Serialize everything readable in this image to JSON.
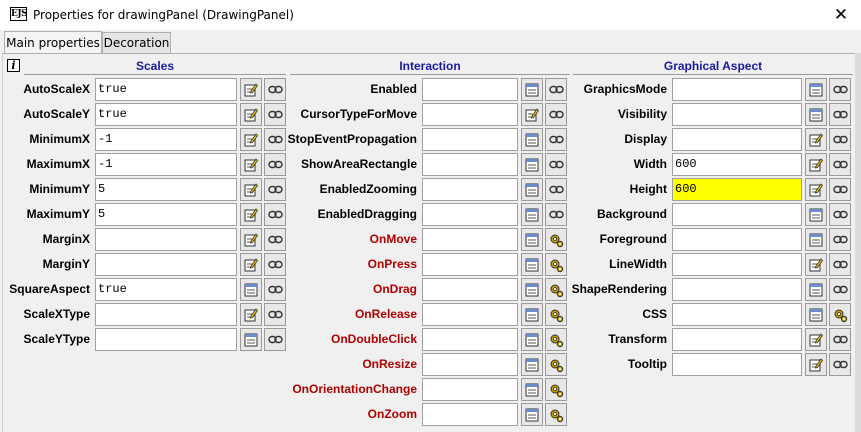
{
  "window": {
    "app_icon_text": "EJS",
    "title": "Properties for drawingPanel (DrawingPanel)"
  },
  "tabs": [
    {
      "label": "Main properties",
      "active": true
    },
    {
      "label": "Decoration",
      "active": false
    }
  ],
  "columns": [
    {
      "header": "Scales",
      "rows": [
        {
          "label": "AutoScaleX",
          "value": "true",
          "kind": "property",
          "edit_icon": "edit-icon"
        },
        {
          "label": "AutoScaleY",
          "value": "true",
          "kind": "property",
          "edit_icon": "edit-icon"
        },
        {
          "label": "MinimumX",
          "value": "-1",
          "kind": "property",
          "edit_icon": "edit-icon"
        },
        {
          "label": "MaximumX",
          "value": "-1",
          "kind": "property",
          "edit_icon": "edit-icon"
        },
        {
          "label": "MinimumY",
          "value": "5",
          "kind": "property",
          "edit_icon": "edit-icon"
        },
        {
          "label": "MaximumY",
          "value": "5",
          "kind": "property",
          "edit_icon": "edit-icon"
        },
        {
          "label": "MarginX",
          "value": "",
          "kind": "property",
          "edit_icon": "edit-icon"
        },
        {
          "label": "MarginY",
          "value": "",
          "kind": "property",
          "edit_icon": "edit-icon"
        },
        {
          "label": "SquareAspect",
          "value": "true",
          "kind": "property",
          "edit_icon": "list-icon"
        },
        {
          "label": "ScaleXType",
          "value": "",
          "kind": "property",
          "edit_icon": "edit-icon"
        },
        {
          "label": "ScaleYType",
          "value": "",
          "kind": "property",
          "edit_icon": "list-icon"
        }
      ]
    },
    {
      "header": "Interaction",
      "rows": [
        {
          "label": "Enabled",
          "value": "",
          "kind": "property",
          "edit_icon": "list-icon"
        },
        {
          "label": "CursorTypeForMove",
          "value": "",
          "kind": "property",
          "edit_icon": "edit-icon"
        },
        {
          "label": "StopEventPropagation",
          "value": "",
          "kind": "property",
          "edit_icon": "list-icon"
        },
        {
          "label": "ShowAreaRectangle",
          "value": "",
          "kind": "property",
          "edit_icon": "list-icon"
        },
        {
          "label": "EnabledZooming",
          "value": "",
          "kind": "property",
          "edit_icon": "list-icon"
        },
        {
          "label": "EnabledDragging",
          "value": "",
          "kind": "property",
          "edit_icon": "list-icon"
        },
        {
          "label": "OnMove",
          "value": "",
          "kind": "action",
          "edit_icon": "list-icon"
        },
        {
          "label": "OnPress",
          "value": "",
          "kind": "action",
          "edit_icon": "list-icon"
        },
        {
          "label": "OnDrag",
          "value": "",
          "kind": "action",
          "edit_icon": "list-icon"
        },
        {
          "label": "OnRelease",
          "value": "",
          "kind": "action",
          "edit_icon": "list-icon"
        },
        {
          "label": "OnDoubleClick",
          "value": "",
          "kind": "action",
          "edit_icon": "list-icon"
        },
        {
          "label": "OnResize",
          "value": "",
          "kind": "action",
          "edit_icon": "list-icon"
        },
        {
          "label": "OnOrientationChange",
          "value": "",
          "kind": "action",
          "edit_icon": "list-icon"
        },
        {
          "label": "OnZoom",
          "value": "",
          "kind": "action",
          "edit_icon": "list-icon"
        }
      ]
    },
    {
      "header": "Graphical Aspect",
      "rows": [
        {
          "label": "GraphicsMode",
          "value": "",
          "kind": "property",
          "edit_icon": "list-icon"
        },
        {
          "label": "Visibility",
          "value": "",
          "kind": "property",
          "edit_icon": "list-icon"
        },
        {
          "label": "Display",
          "value": "",
          "kind": "property",
          "edit_icon": "edit-icon"
        },
        {
          "label": "Width",
          "value": "600",
          "kind": "property",
          "edit_icon": "edit-icon"
        },
        {
          "label": "Height",
          "value": "600",
          "kind": "property",
          "edit_icon": "edit-icon",
          "highlighted": true
        },
        {
          "label": "Background",
          "value": "",
          "kind": "property",
          "edit_icon": "list-icon"
        },
        {
          "label": "Foreground",
          "value": "",
          "kind": "property",
          "edit_icon": "list-icon"
        },
        {
          "label": "LineWidth",
          "value": "",
          "kind": "property",
          "edit_icon": "edit-icon"
        },
        {
          "label": "ShapeRendering",
          "value": "",
          "kind": "property",
          "edit_icon": "list-icon"
        },
        {
          "label": "CSS",
          "value": "",
          "kind": "property",
          "edit_icon": "list-icon",
          "link_icon": "gear-icon"
        },
        {
          "label": "Transform",
          "value": "",
          "kind": "property",
          "edit_icon": "edit-icon"
        },
        {
          "label": "Tooltip",
          "value": "",
          "kind": "property",
          "edit_icon": "edit-icon"
        }
      ]
    }
  ],
  "colors": {
    "header_text": "#1a1aa0",
    "action_label": "#b00000",
    "highlight": "#ffff00"
  }
}
